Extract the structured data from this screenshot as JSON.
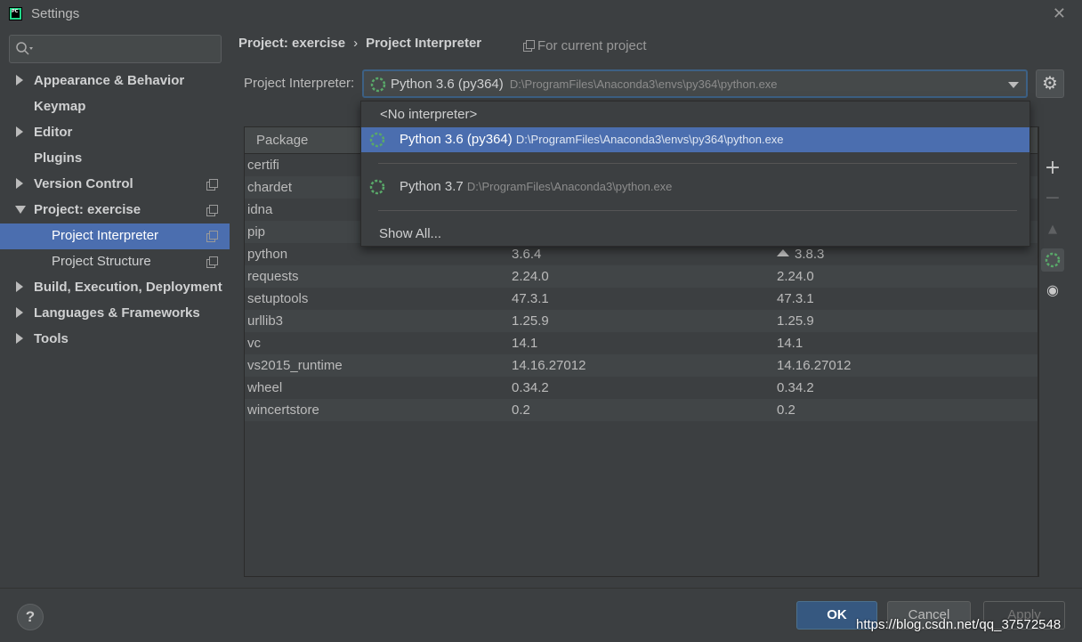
{
  "window": {
    "title": "Settings",
    "close_glyph": "✕"
  },
  "sidebar": {
    "search_placeholder": "",
    "items": [
      {
        "label": "Appearance & Behavior",
        "expandable": true
      },
      {
        "label": "Keymap",
        "expandable": false
      },
      {
        "label": "Editor",
        "expandable": true
      },
      {
        "label": "Plugins",
        "expandable": false
      },
      {
        "label": "Version Control",
        "expandable": true
      },
      {
        "label": "Project: exercise",
        "expandable": true,
        "expanded": true
      },
      {
        "label": "Project Interpreter",
        "selected": true
      },
      {
        "label": "Project Structure"
      },
      {
        "label": "Build, Execution, Deployment",
        "expandable": true
      },
      {
        "label": "Languages & Frameworks",
        "expandable": true
      },
      {
        "label": "Tools",
        "expandable": true
      }
    ]
  },
  "breadcrumb": {
    "part1": "Project: exercise",
    "separator": "›",
    "part2": "Project Interpreter"
  },
  "scope_hint": "For current project",
  "interpreter": {
    "label": "Project Interpreter:",
    "selected_name": "Python 3.6 (py364)",
    "selected_path": "D:\\ProgramFiles\\Anaconda3\\envs\\py364\\python.exe"
  },
  "dropdown": {
    "no_interpreter": "<No interpreter>",
    "options": [
      {
        "name": "Python 3.6 (py364)",
        "path": "D:\\ProgramFiles\\Anaconda3\\envs\\py364\\python.exe",
        "selected": true
      },
      {
        "name": "Python 3.7",
        "path": "D:\\ProgramFiles\\Anaconda3\\python.exe",
        "selected": false
      }
    ],
    "show_all": "Show All..."
  },
  "table": {
    "columns": [
      "Package",
      "",
      ""
    ],
    "rows": [
      {
        "package": "certifi",
        "version": "",
        "latest": ""
      },
      {
        "package": "chardet",
        "version": "",
        "latest": ""
      },
      {
        "package": "idna",
        "version": "",
        "latest": ""
      },
      {
        "package": "pip",
        "version": "",
        "latest": ""
      },
      {
        "package": "python",
        "version": "3.6.4",
        "latest": "3.8.3",
        "upgrade": true
      },
      {
        "package": "requests",
        "version": "2.24.0",
        "latest": "2.24.0"
      },
      {
        "package": "setuptools",
        "version": "47.3.1",
        "latest": "47.3.1"
      },
      {
        "package": "urllib3",
        "version": "1.25.9",
        "latest": "1.25.9"
      },
      {
        "package": "vc",
        "version": "14.1",
        "latest": "14.1"
      },
      {
        "package": "vs2015_runtime",
        "version": "14.16.27012",
        "latest": "14.16.27012"
      },
      {
        "package": "wheel",
        "version": "0.34.2",
        "latest": "0.34.2"
      },
      {
        "package": "wincertstore",
        "version": "0.2",
        "latest": "0.2"
      }
    ]
  },
  "toolbar": {
    "add": "+",
    "remove": "−",
    "upgrade": "▲",
    "eye": "◉"
  },
  "buttons": {
    "help": "?",
    "ok": "OK",
    "cancel": "Cancel",
    "apply": "Apply"
  },
  "watermark": "https://blog.csdn.net/qq_37572548",
  "colors": {
    "accent": "#4b6eaf",
    "spinner": "#59a869",
    "background": "#3c3f41"
  },
  "icons": {
    "logo": "pycharm-logo-icon",
    "search": "search-icon",
    "gear": "gear-icon",
    "copy": "copy-icon",
    "spinner": "python-env-icon"
  }
}
